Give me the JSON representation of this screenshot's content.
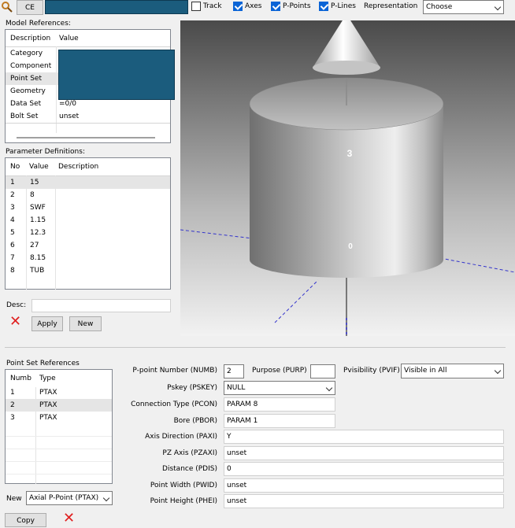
{
  "toolbar": {
    "ce_label": "CE",
    "track_label": "Track",
    "axes_label": "Axes",
    "ppoints_label": "P-Points",
    "plines_label": "P-Lines",
    "representation_label": "Representation",
    "representation_value": "Choose",
    "track_checked": false,
    "axes_checked": true,
    "ppoints_checked": true,
    "plines_checked": true
  },
  "model_refs": {
    "title": "Model References:",
    "col_description": "Description",
    "col_value": "Value",
    "rows": [
      {
        "desc": "Category",
        "value": ""
      },
      {
        "desc": "Component",
        "value": ""
      },
      {
        "desc": "Point Set",
        "value": ""
      },
      {
        "desc": "Geometry",
        "value": ""
      },
      {
        "desc": "Data Set",
        "value": "=0/0"
      },
      {
        "desc": "Bolt Set",
        "value": "unset"
      }
    ]
  },
  "param_defs": {
    "title": "Parameter Definitions:",
    "col_no": "No",
    "col_value": "Value",
    "col_description": "Description",
    "rows": [
      {
        "no": "1",
        "value": "15"
      },
      {
        "no": "2",
        "value": "8"
      },
      {
        "no": "3",
        "value": "SWF"
      },
      {
        "no": "4",
        "value": "1.15"
      },
      {
        "no": "5",
        "value": "12.3"
      },
      {
        "no": "6",
        "value": "27"
      },
      {
        "no": "7",
        "value": "8.15"
      },
      {
        "no": "8",
        "value": "TUB"
      }
    ]
  },
  "desc_form": {
    "desc_label": "Desc:",
    "desc_value": "",
    "apply_label": "Apply",
    "new_label": "New"
  },
  "viewport": {
    "label_top": "3",
    "label_bottom": "0"
  },
  "point_set_refs": {
    "title": "Point Set References",
    "col_numb": "Numb",
    "col_type": "Type",
    "rows": [
      {
        "numb": "1",
        "type": "PTAX"
      },
      {
        "numb": "2",
        "type": "PTAX"
      },
      {
        "numb": "3",
        "type": "PTAX"
      }
    ],
    "new_label": "New",
    "new_value": "Axial P-Point (PTAX)",
    "copy_label": "Copy"
  },
  "ppoint_form": {
    "numb_label": "P-point Number (NUMB)",
    "numb_value": "2",
    "purp_label": "Purpose (PURP)",
    "purp_value": "",
    "pvif_label": "Pvisibility (PVIF)",
    "pvif_value": "Visible in All",
    "pskey_label": "Pskey (PSKEY)",
    "pskey_value": "NULL",
    "pcon_label": "Connection Type (PCON)",
    "pcon_value": "PARAM 8",
    "pbor_label": "Bore (PBOR)",
    "pbor_value": "PARAM 1",
    "paxi_label": "Axis Direction (PAXI)",
    "paxi_value": "Y",
    "pzaxi_label": "PZ Axis (PZAXI)",
    "pzaxi_value": "unset",
    "pdis_label": "Distance (PDIS)",
    "pdis_value": "0",
    "pwid_label": "Point Width (PWID)",
    "pwid_value": "unset",
    "phei_label": "Point Height (PHEI)",
    "phei_value": "unset"
  },
  "colors": {
    "redaction": "#1b5c7d",
    "delete_red": "#e02020",
    "check_blue": "#0a64d6",
    "axis_blue": "#3333cc"
  }
}
